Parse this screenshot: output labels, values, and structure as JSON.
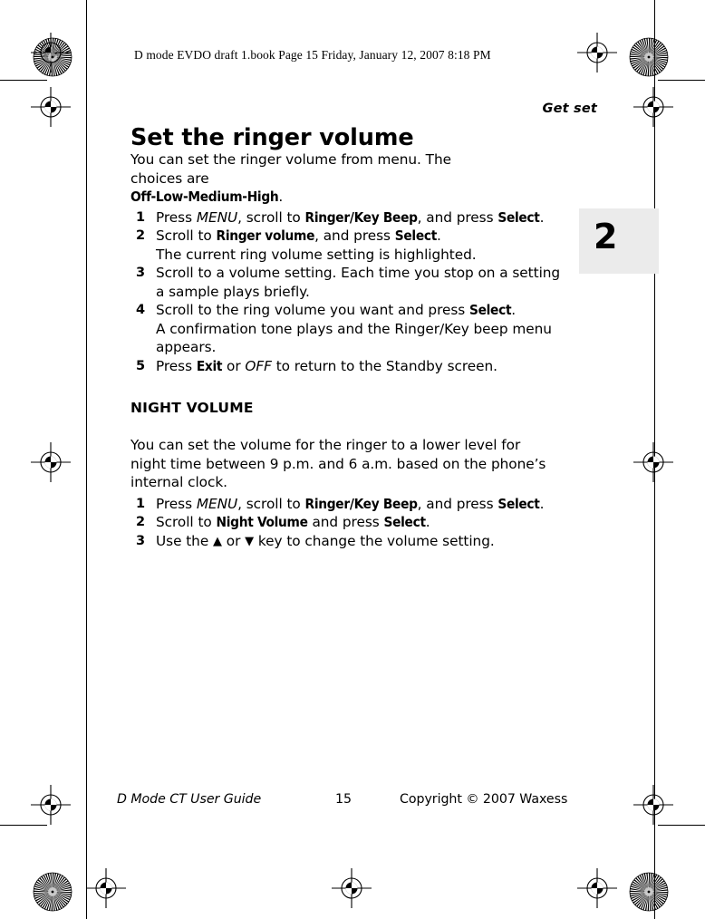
{
  "print_header": {
    "text": "D mode EVDO draft 1.book  Page 15  Friday, January 12, 2007  8:18 PM"
  },
  "running_head": {
    "label": "Get set"
  },
  "chapter_tab": {
    "number": "2",
    "background": "#ebebeb"
  },
  "page_title": "Set the ringer volume",
  "intro": {
    "line1": "You can set the ringer volume from menu. The",
    "line2": "choices are",
    "choices": "Off-Low-Medium-High",
    "period": "."
  },
  "steps_primary": [
    {
      "marker": "1",
      "parts": [
        {
          "type": "text",
          "value": "Press "
        },
        {
          "type": "key",
          "value": "MENU"
        },
        {
          "type": "text",
          "value": ", scroll to "
        },
        {
          "type": "ui",
          "value": "Ringer/Key Beep"
        },
        {
          "type": "text",
          "value": ", and press "
        },
        {
          "type": "ui",
          "value": "Select"
        },
        {
          "type": "text",
          "value": "."
        }
      ]
    },
    {
      "marker": "2",
      "parts": [
        {
          "type": "text",
          "value": "Scroll to "
        },
        {
          "type": "ui",
          "value": "Ringer volume"
        },
        {
          "type": "text",
          "value": ", and press "
        },
        {
          "type": "ui",
          "value": "Select"
        },
        {
          "type": "text",
          "value": "."
        }
      ],
      "note": "The current ring volume setting is highlighted."
    },
    {
      "marker": "3",
      "parts": [
        {
          "type": "text",
          "value": "Scroll to a volume setting. Each time you stop on a setting a sample plays briefly."
        }
      ]
    },
    {
      "marker": "4",
      "parts": [
        {
          "type": "text",
          "value": "Scroll to the ring volume you want and press "
        },
        {
          "type": "ui",
          "value": "Select"
        },
        {
          "type": "text",
          "value": "."
        }
      ],
      "note": "A confirmation tone plays and the Ringer/Key beep menu appears."
    },
    {
      "marker": "5",
      "parts": [
        {
          "type": "text",
          "value": "Press "
        },
        {
          "type": "ui",
          "value": "Exit"
        },
        {
          "type": "text",
          "value": " or "
        },
        {
          "type": "key",
          "value": "OFF"
        },
        {
          "type": "text",
          "value": " to return to the Standby screen."
        }
      ]
    }
  ],
  "subhead": "NIGHT VOLUME",
  "night_intro": "You can set the volume for the ringer to a lower level for night time between 9 p.m. and 6 a.m. based on the phone’s internal clock.",
  "steps_night": [
    {
      "marker": "1",
      "parts": [
        {
          "type": "text",
          "value": "Press "
        },
        {
          "type": "key",
          "value": "MENU"
        },
        {
          "type": "text",
          "value": ", scroll to "
        },
        {
          "type": "ui",
          "value": "Ringer/Key Beep"
        },
        {
          "type": "text",
          "value": ", and press "
        },
        {
          "type": "ui",
          "value": "Select"
        },
        {
          "type": "text",
          "value": "."
        }
      ]
    },
    {
      "marker": "2",
      "parts": [
        {
          "type": "text",
          "value": "Scroll to "
        },
        {
          "type": "ui",
          "value": "Night Volume"
        },
        {
          "type": "text",
          "value": " and press "
        },
        {
          "type": "ui",
          "value": "Select"
        },
        {
          "type": "text",
          "value": "."
        }
      ]
    },
    {
      "marker": "3",
      "parts": [
        {
          "type": "text",
          "value": "Use the "
        },
        {
          "type": "glyph",
          "value": "▲"
        },
        {
          "type": "text",
          "value": " or "
        },
        {
          "type": "glyph",
          "value": "▼"
        },
        {
          "type": "text",
          "value": " key to change the volume setting."
        }
      ]
    }
  ],
  "footer": {
    "guide": "D Mode CT User Guide",
    "page_number": "15",
    "copyright": "Copyright © 2007 Waxess"
  }
}
